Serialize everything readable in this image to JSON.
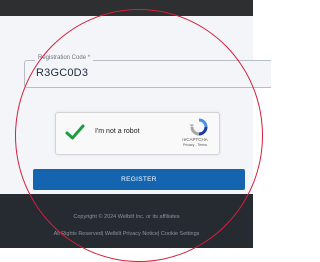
{
  "registration": {
    "label": "Registration Code *",
    "value": "R3GC0D3"
  },
  "captcha": {
    "label": "I'm not a robot",
    "brand": "reCAPTCHA",
    "privacy": "Privacy",
    "separator": " - ",
    "terms": "Terms"
  },
  "register": {
    "label": "REGISTER"
  },
  "footer": {
    "copyright": "Copyright © 2024 Welbilt Inc. or its affiliates",
    "rights": "All Rights Reserved",
    "privacy_notice": "Welbilt Privacy Notice",
    "cookie": "Cookie Settings",
    "separator": "| "
  },
  "colors": {
    "brand_blue": "#1564b0",
    "footer_bg": "#262a31",
    "form_bg": "#f3f5f9",
    "accent_red": "#d81e3c"
  }
}
